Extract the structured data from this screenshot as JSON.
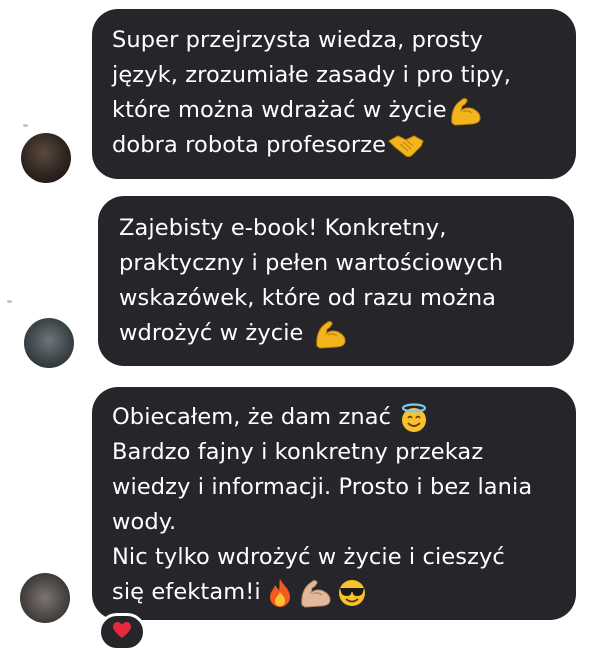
{
  "messages": [
    {
      "lines": [
        "Super przejrzysta wiedza, prosty",
        "język, zrozumiałe zasady i pro tipy,",
        "które można wdrażać w życie",
        "dobra robota profesorze"
      ],
      "emojis": [
        "flexed-biceps",
        "handshake"
      ]
    },
    {
      "lines": [
        "Zajebisty e-book! Konkretny,",
        "praktyczny i pełen wartościowych",
        "wskazówek, które od razu można",
        "wdrożyć w życie"
      ],
      "emojis": [
        "flexed-biceps"
      ]
    },
    {
      "lines": [
        "Obiecałem, że dam znać",
        "Bardzo fajny i konkretny przekaz",
        "wiedzy i informacji. Prosto i bez lania",
        "wody.",
        "Nic tylko wdrożyć w życie i cieszyć",
        "się efektam!i"
      ],
      "emojis": [
        "smiling-face-with-halo",
        "fire",
        "flexed-biceps",
        "smiling-face-with-sunglasses"
      ]
    }
  ],
  "reaction": {
    "emoji": "red-heart"
  },
  "colors": {
    "bubble": "#26252a",
    "text": "#ffffff",
    "background": "#ffffff"
  }
}
